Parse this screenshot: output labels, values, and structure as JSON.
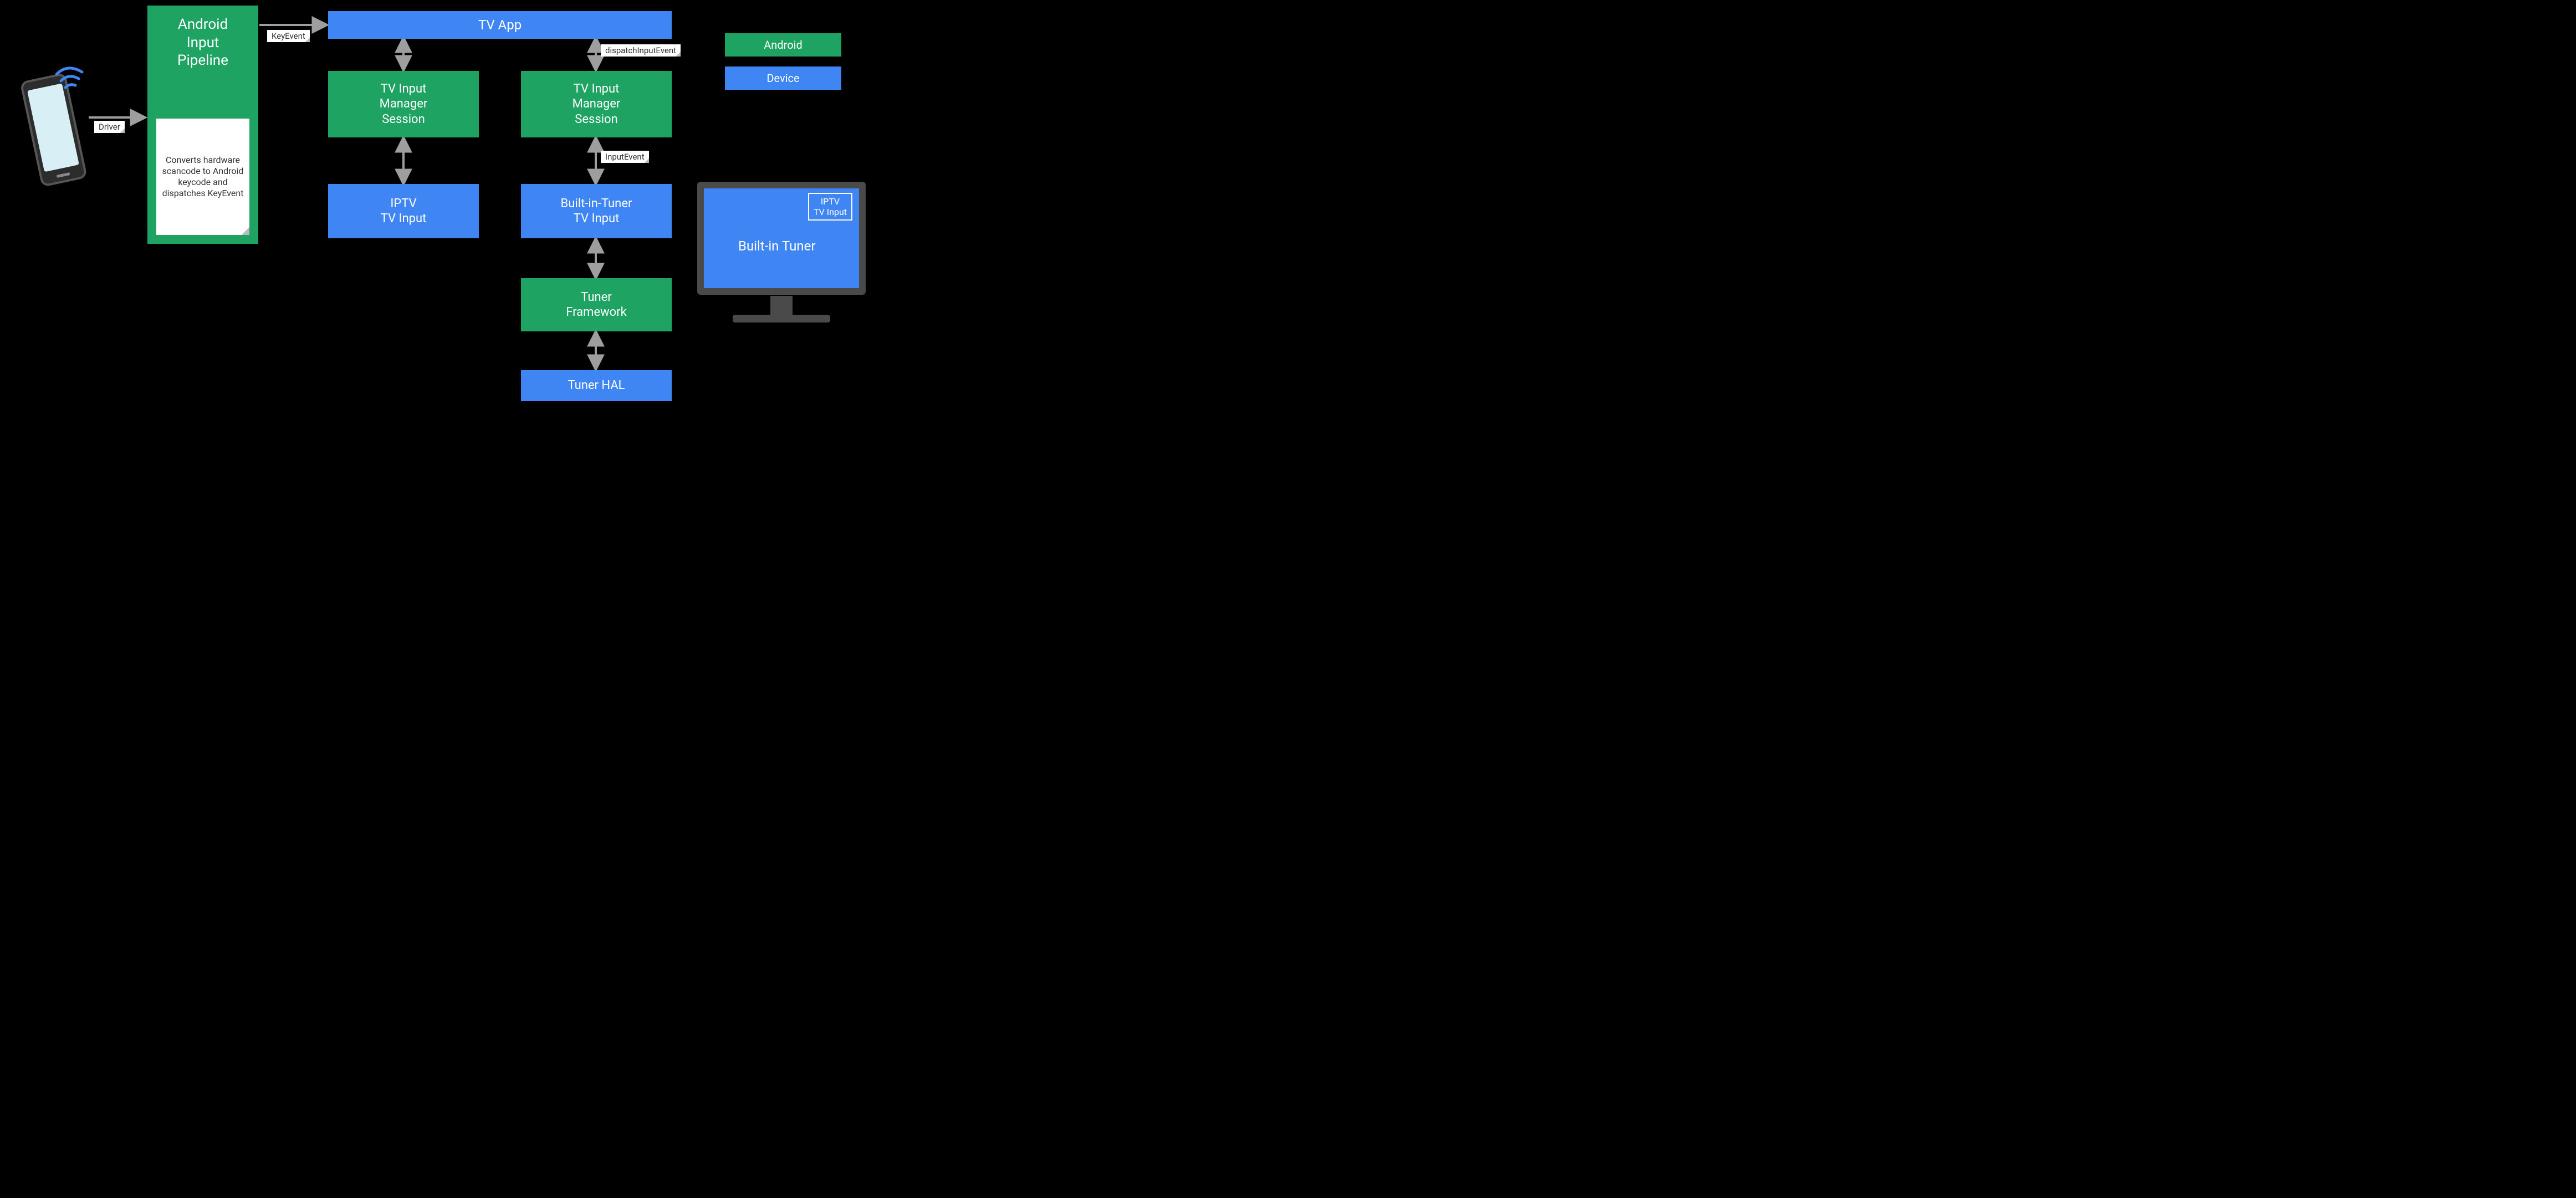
{
  "colors": {
    "android": "#1ea362",
    "device": "#3f85f4",
    "arrow": "#9e9e9e",
    "note_bg": "#ffffff"
  },
  "legend": {
    "android": "Android",
    "device": "Device"
  },
  "nodes": {
    "android_input_pipeline": "Android\nInput\nPipeline",
    "pipeline_note": "Converts hardware scancode to Android keycode and dispatches KeyEvent",
    "tv_app": "TV App",
    "tims_left": "TV Input\nManager\nSession",
    "tims_right": "TV Input\nManager\nSession",
    "iptv_input": "IPTV\nTV Input",
    "builtin_tuner_input": "Built-in-Tuner\nTV Input",
    "tuner_framework": "Tuner\nFramework",
    "tuner_hal": "Tuner HAL"
  },
  "edge_labels": {
    "driver": "Driver",
    "key_event": "KeyEvent",
    "dispatch_input_event": "dispatchInputEvent",
    "input_event": "InputEvent"
  },
  "tv_display": {
    "label": "Built-in Tuner",
    "badge": "IPTV\nTV Input"
  },
  "edges": [
    {
      "from": "phone",
      "to": "android_input_pipeline",
      "dir": "uni",
      "label": "driver"
    },
    {
      "from": "android_input_pipeline",
      "to": "tv_app",
      "dir": "uni",
      "label": "key_event"
    },
    {
      "from": "tv_app",
      "to": "tims_left",
      "dir": "bi"
    },
    {
      "from": "tv_app",
      "to": "tims_right",
      "dir": "bi",
      "label": "dispatch_input_event"
    },
    {
      "from": "tims_left",
      "to": "iptv_input",
      "dir": "bi"
    },
    {
      "from": "tims_right",
      "to": "builtin_tuner_input",
      "dir": "bi",
      "label": "input_event"
    },
    {
      "from": "builtin_tuner_input",
      "to": "tuner_framework",
      "dir": "bi"
    },
    {
      "from": "tuner_framework",
      "to": "tuner_hal",
      "dir": "bi"
    }
  ]
}
